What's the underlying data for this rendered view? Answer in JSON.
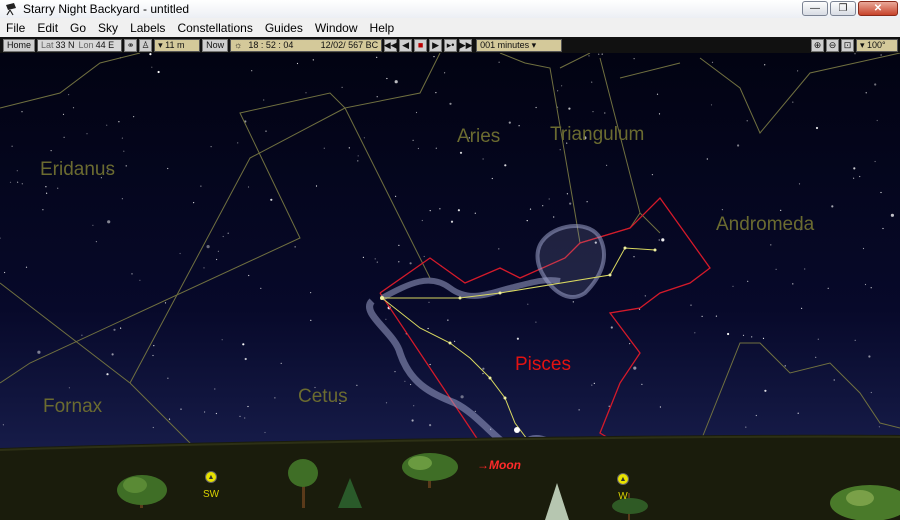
{
  "window": {
    "title": "Starry Night Backyard - untitled",
    "buttons": {
      "minimize": "—",
      "maximize": "❐",
      "close": "✕"
    }
  },
  "menu": [
    "File",
    "Edit",
    "Go",
    "Sky",
    "Labels",
    "Constellations",
    "Guides",
    "Window",
    "Help"
  ],
  "toolbar": {
    "home_label": "Home",
    "lat_label": "Lat",
    "lat_value": "33 N",
    "lon_label": "Lon",
    "lon_value": "44 E",
    "elevation": "▾ 11 m",
    "now_label": "Now",
    "time": "18 : 52 : 04",
    "date": "12/02/  567 BC",
    "step": "001 minutes ▾",
    "fov": "▾ 100°"
  },
  "constellations": {
    "eridanus": "Eridanus",
    "aries": "Aries",
    "triangulum": "Triangulum",
    "andromeda": "Andromeda",
    "pisces": "Pisces",
    "cetus": "Cetus",
    "fornax": "Fornax"
  },
  "sky_objects": {
    "moon": "→Moon"
  },
  "horizon": {
    "sw": "SW",
    "w": "W"
  },
  "colors": {
    "boundary": "#707040",
    "selected_boundary": "#d41a2a",
    "stick_figure": "#d8d860",
    "label": "#6b6b30",
    "selected_label": "#e21212"
  }
}
